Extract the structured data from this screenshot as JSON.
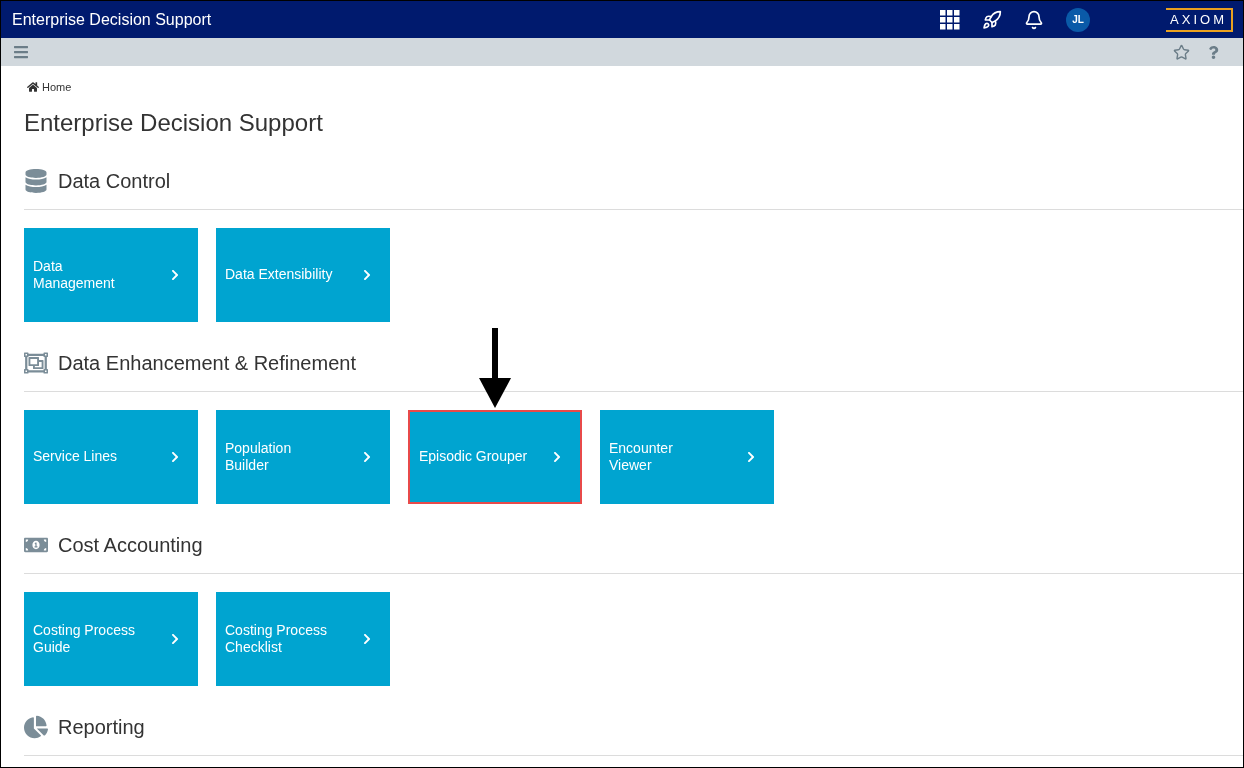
{
  "header": {
    "title": "Enterprise Decision Support",
    "avatar": "JL",
    "logo": "AXIOM"
  },
  "breadcrumb": "Home",
  "page_title": "Enterprise Decision Support",
  "sections": [
    {
      "title": "Data Control",
      "kind": "database",
      "tiles": [
        {
          "lines": [
            "Data",
            "Management"
          ],
          "highlighted": false
        },
        {
          "lines": [
            "Data Extensibility"
          ],
          "highlighted": false
        }
      ]
    },
    {
      "title": "Data Enhancement & Refinement",
      "kind": "group",
      "tiles": [
        {
          "lines": [
            "Service Lines"
          ],
          "highlighted": false
        },
        {
          "lines": [
            "Population",
            "Builder"
          ],
          "highlighted": false
        },
        {
          "lines": [
            "Episodic Grouper"
          ],
          "highlighted": true
        },
        {
          "lines": [
            "Encounter",
            "Viewer"
          ],
          "highlighted": false
        }
      ]
    },
    {
      "title": "Cost Accounting",
      "kind": "money",
      "tiles": [
        {
          "lines": [
            "Costing Process",
            "Guide"
          ],
          "highlighted": false
        },
        {
          "lines": [
            "Costing Process",
            "Checklist"
          ],
          "highlighted": false
        }
      ]
    },
    {
      "title": "Reporting",
      "kind": "chart"
    }
  ]
}
